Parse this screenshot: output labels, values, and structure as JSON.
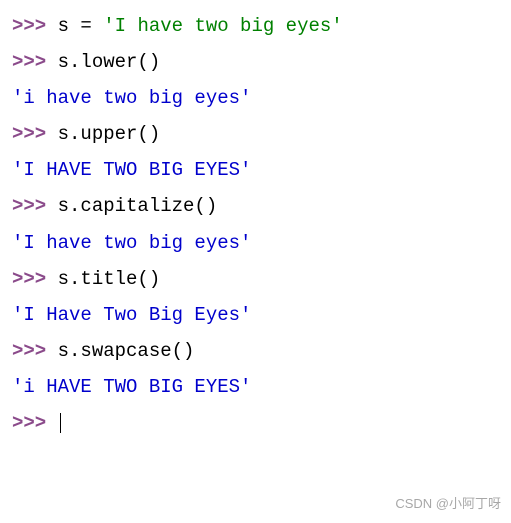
{
  "prompt": ">>> ",
  "lines": {
    "l1_var": "s",
    "l1_op": " = ",
    "l1_str": "'I have two big eyes'",
    "l2_code": "s.lower()",
    "l3_out": "'i have two big eyes'",
    "l4_code": "s.upper()",
    "l5_out": "'I HAVE TWO BIG EYES'",
    "l6_code": "s.capitalize()",
    "l7_out": "'I have two big eyes'",
    "l8_code": "s.title()",
    "l9_out": "'I Have Two Big Eyes'",
    "l10_code": "s.swapcase()",
    "l11_out": "'i HAVE TWO BIG EYES'"
  },
  "watermark": "CSDN @小阿丁呀"
}
